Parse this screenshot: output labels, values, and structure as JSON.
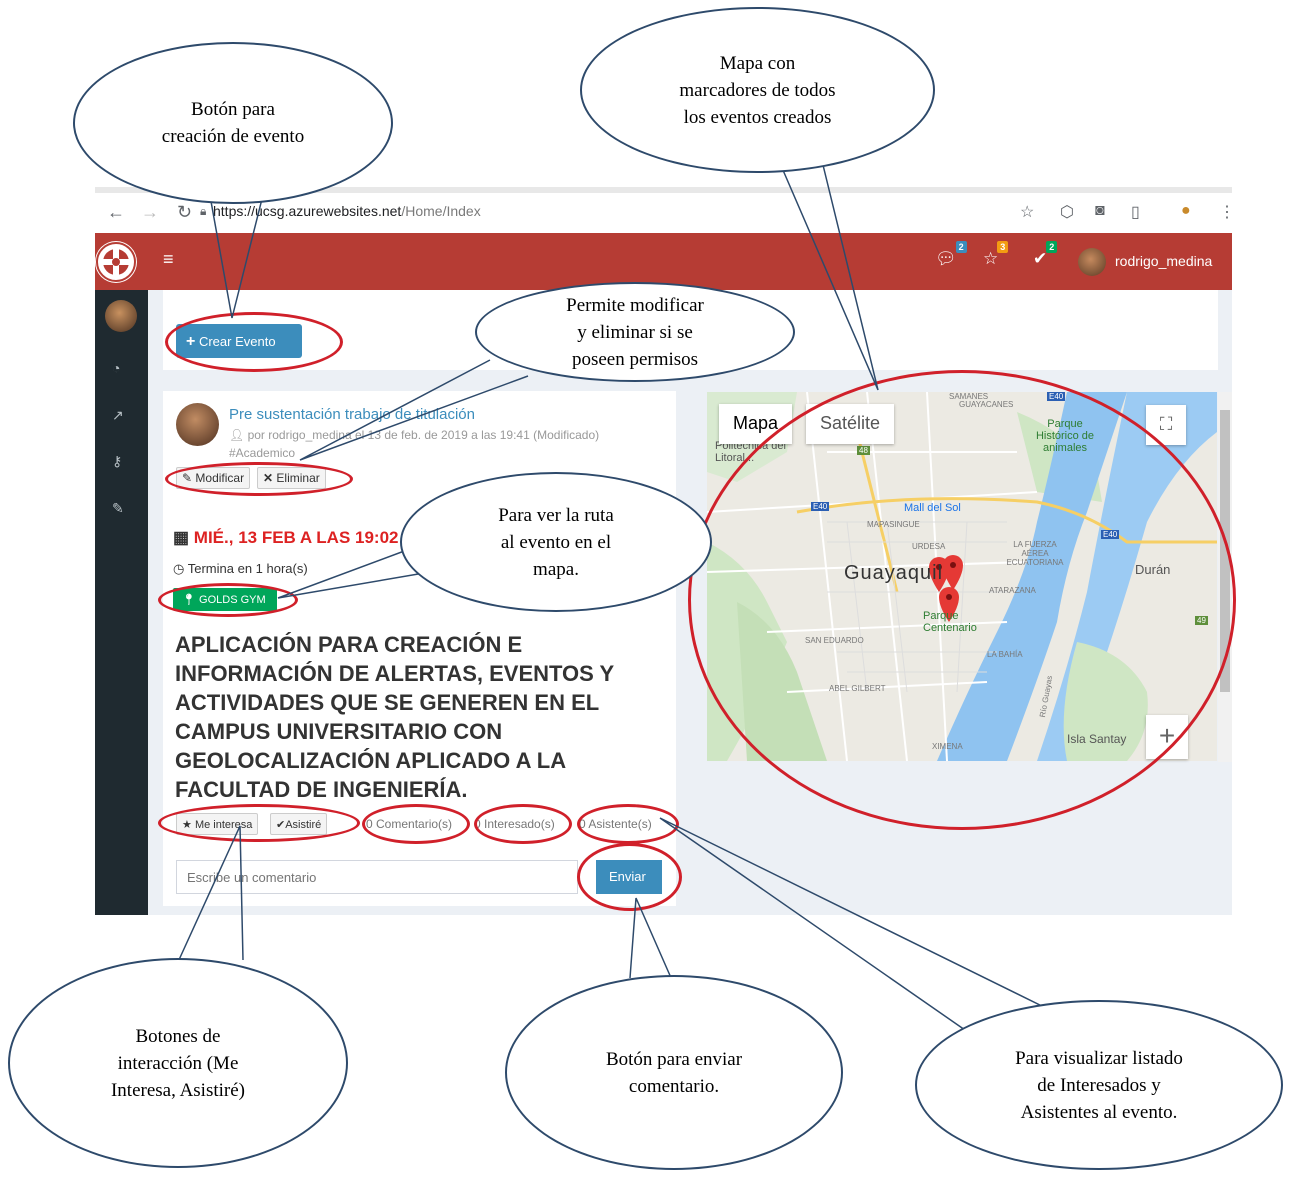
{
  "browser": {
    "url_host": "https://ucsg.azurewebsites.net",
    "url_path": "/Home/Index"
  },
  "header": {
    "menu_icon": "hamburger-icon",
    "notifications": [
      {
        "icon": "comments-icon",
        "count": "2",
        "color": "#3c8dbc"
      },
      {
        "icon": "star-icon",
        "count": "3",
        "color": "#f39c12"
      },
      {
        "icon": "check-icon",
        "count": "2",
        "color": "#00a65a"
      }
    ],
    "user_name": "rodrigo_medina"
  },
  "sidebar": {
    "icons": [
      "dashboard-icon",
      "chart-icon",
      "key-icon",
      "edit-icon"
    ]
  },
  "toolbar": {
    "create_event_label": "Crear Evento"
  },
  "event": {
    "title": "Pre sustentación trabajo de titulación",
    "meta": "por rodrigo_medina el 13 de feb. de 2019 a las 19:41 (Modificado)",
    "tag": "#Academico",
    "edit_label": "Modificar",
    "delete_label": "Eliminar",
    "date": "MIÉ., 13 FEB A LAS 19:02",
    "ends": "Termina en 1 hora(s)",
    "place": "GOLDS GYM",
    "body": "APLICACIÓN PARA CREACIÓN E INFORMACIÓN DE ALERTAS, EVENTOS Y ACTIVIDADES QUE SE GENEREN EN EL CAMPUS UNIVERSITARIO CON GEOLOCALIZACIÓN APLICADO A LA FACULTAD DE INGENIERÍA.",
    "interest_label": "Me interesa",
    "attend_label": "Asistiré",
    "comments_count": "0 Comentario(s)",
    "interested_count": "0 Interesado(s)",
    "attendees_count": "0 Asistente(s)",
    "comment_placeholder": "Escribe un comentario",
    "send_label": "Enviar"
  },
  "map": {
    "type_map": "Mapa",
    "type_satellite": "Satélite",
    "labels": {
      "samanes": "SAMANES",
      "guayacanes": "GUAYACANES",
      "parque_historico": "Parque Histórico de animales",
      "politecnica": "Politécnica del Litoral...",
      "mall_del_sol": "Mall del Sol",
      "mapasingue": "MAPASINGUE",
      "urdesa": "URDESA",
      "la_fuerza": "LA FUERZA AÉREA ECUATORIANA",
      "guayaquil": "Guayaquil",
      "duran": "Durán",
      "atarazana": "ATARAZANA",
      "parque_centenario": "Parque Centenario",
      "san_eduardo": "SAN EDUARDO",
      "la_bahia": "LA BAHÍA",
      "abel_gilbert": "ABEL GILBERT",
      "rio_guayas": "Río Guayas",
      "isla_santay": "Isla Santay",
      "ximena": "XIMENA",
      "road_48": "48",
      "road_e40a": "E40",
      "road_e40b": "E40",
      "road_e40c": "E40",
      "road_49": "49"
    }
  },
  "annotations": {
    "crear": "Botón para\ncreación de evento",
    "mapa": "Mapa con\nmarcadores de todos\nlos eventos creados",
    "modificar": "Permite modificar\ny eliminar si se\nposeen permisos",
    "ruta": "Para ver la ruta\nal evento en el\nmapa.",
    "interaccion": "Botones de\ninteracción (Me\nInteresa, Asistiré)",
    "enviar": "Botón para enviar\ncomentario.",
    "listado": "Para visualizar listado\nde Interesados y\nAsistentes al evento."
  }
}
